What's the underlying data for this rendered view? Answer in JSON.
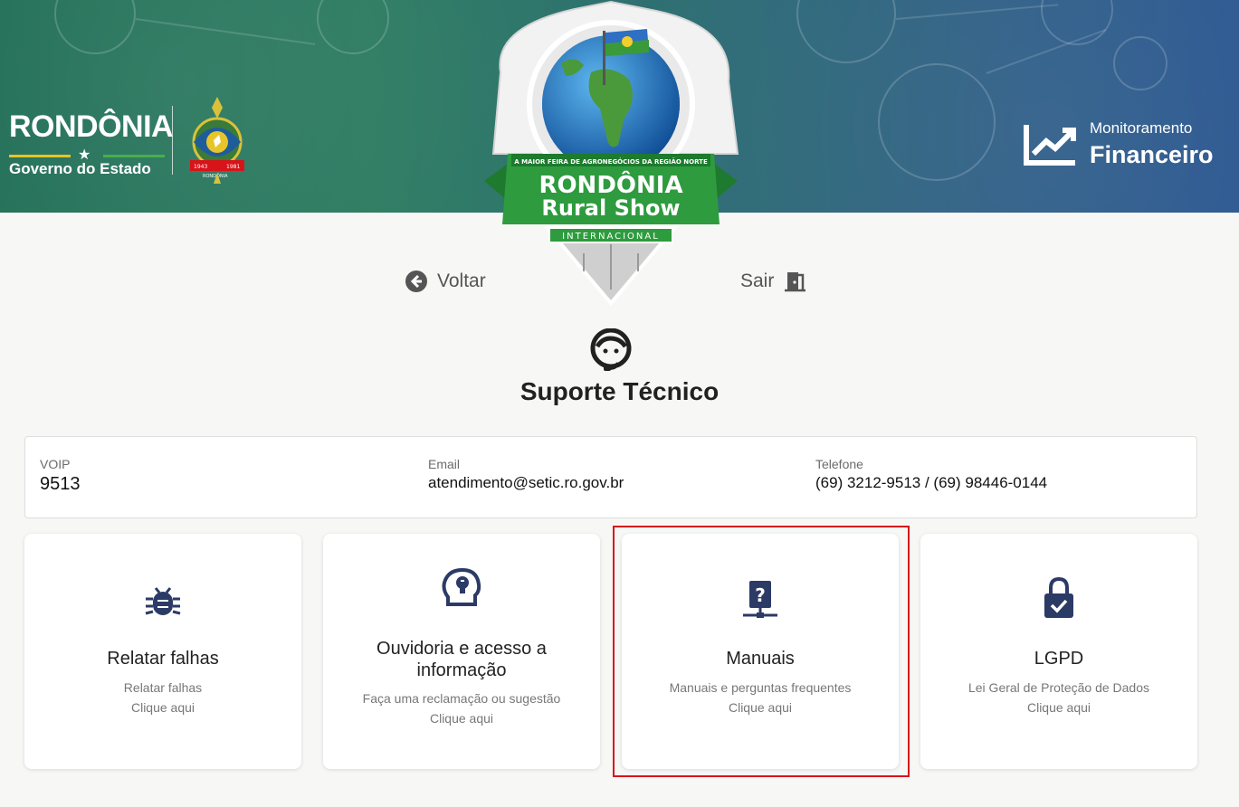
{
  "banner": {
    "gov_name": "RONDÔNIA",
    "gov_sub": "Governo do Estado",
    "coat_years_left": "1943",
    "coat_years_right": "1981",
    "coat_label": "RONDÔNIA",
    "monit_label": "Monitoramento",
    "monit_title": "Financeiro",
    "badge_top": "A MAIOR FEIRA DE AGRONEGÓCIOS DA REGIÃO NORTE",
    "badge_title_1": "RONDÔNIA",
    "badge_title_2": "Rural Show",
    "badge_sub": "INTERNACIONAL"
  },
  "nav": {
    "back_label": "Voltar",
    "exit_label": "Sair"
  },
  "support": {
    "title": "Suporte Técnico"
  },
  "contact": {
    "voip_label": "VOIP",
    "voip_value": "9513",
    "email_label": "Email",
    "email_value": "atendimento@setic.ro.gov.br",
    "phone_label": "Telefone",
    "phone_value": "(69) 3212-9513 / (69) 98446-0144"
  },
  "cards": [
    {
      "title": "Relatar falhas",
      "desc": "Relatar falhas",
      "cta": "Clique aqui",
      "icon": "bug-icon"
    },
    {
      "title": "Ouvidoria e acesso a informação",
      "desc": "Faça uma reclamação ou sugestão",
      "cta": "Clique aqui",
      "icon": "head-lightbulb-icon"
    },
    {
      "title": "Manuais",
      "desc": "Manuais e perguntas frequentes",
      "cta": "Clique aqui",
      "icon": "manual-question-icon"
    },
    {
      "title": "LGPD",
      "desc": "Lei Geral de Proteção de Dados",
      "cta": "Clique aqui",
      "icon": "lock-check-icon"
    }
  ],
  "colors": {
    "icon": "#2c3a66",
    "highlight": "#d7141a",
    "badge_green": "#2e9b3e"
  }
}
